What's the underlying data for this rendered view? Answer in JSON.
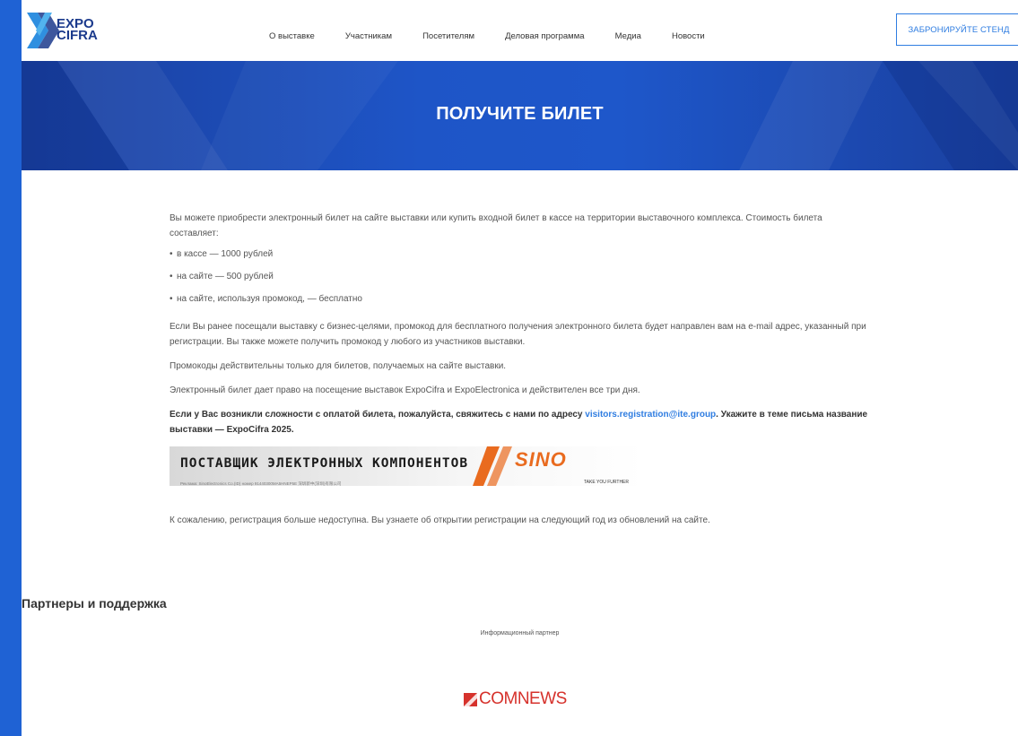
{
  "logo": {
    "line1": "EXPO",
    "line2": "CIFRA"
  },
  "nav": {
    "items": [
      {
        "label": "О выставке"
      },
      {
        "label": "Участникам"
      },
      {
        "label": "Посетителям"
      },
      {
        "label": "Деловая программа"
      },
      {
        "label": "Медиа"
      },
      {
        "label": "Новости"
      }
    ],
    "book_button": "ЗАБРОНИРУЙТЕ СТЕНД"
  },
  "hero": {
    "title": "ПОЛУЧИТЕ БИЛЕТ"
  },
  "content": {
    "intro": "Вы можете приобрести электронный билет на сайте выставки или купить входной билет в кассе на территории выставочного комплекса. Стоимость билета составляет:",
    "prices": [
      "в кассе — 1000 рублей",
      "на сайте — 500 рублей",
      "на сайте, используя промокод, — бесплатно"
    ],
    "paragraph1": "Если Вы ранее посещали выставку с бизнес-целями, промокод для бесплатного получения электронного билета будет направлен вам на e-mail адрес, указанный при регистрации. Вы также можете получить промокод у любого из участников выставки.",
    "paragraph2": "Промокоды действительны только для билетов, получаемых на сайте выставки.",
    "paragraph3": "Электронный билет дает право на посещение выставок ExpoCifra и ExpoElectronica и действителен все три дня.",
    "contact_prefix": "Если у Вас возникли сложности с оплатой билета, пожалуйста, свяжитесь с нами по адресу ",
    "contact_email": "visitors.registration@ite.group",
    "contact_suffix": ". Укажите в теме письма название выставки — ExpoCifra 2025.",
    "banner": {
      "text": "ПОСТАВЩИК ЭЛЕКТРОННЫХ КОМПОНЕНТОВ",
      "small": "Реклама: SinoElectronics Co.(ID) номер 91440300MA5HNEP5E   深圳新中(深圳)有限公司",
      "logo": "SINO",
      "tagline": "TAKE YOU FURTHER"
    },
    "note": "К сожалению, регистрация больше недоступна. Вы узнаете об открытии регистрации на следующий год из обновлений на сайте."
  },
  "partners": {
    "title": "Партнеры и поддержка",
    "label": "Информационный партнер",
    "logo": "COMNEWS"
  },
  "colors": {
    "page_background": "#1f62d4",
    "hero": "#1e55c7",
    "accent": "#2f7de1",
    "banner_logo": "#e96b1f",
    "comnews": "#d6322c"
  }
}
